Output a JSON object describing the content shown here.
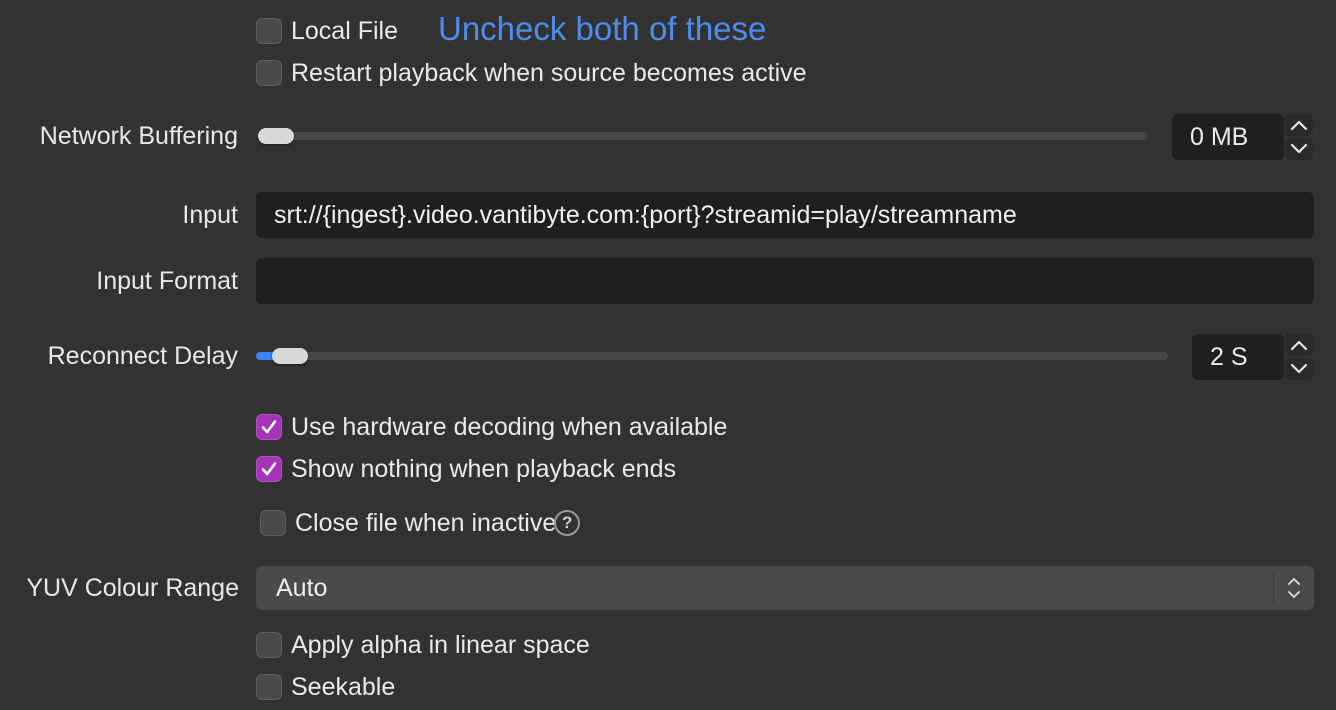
{
  "checkboxes": {
    "local_file": {
      "label": "Local File",
      "checked": false
    },
    "restart_playback": {
      "label": "Restart playback when source becomes active",
      "checked": false
    },
    "hw_decoding": {
      "label": "Use hardware decoding when available",
      "checked": true
    },
    "show_nothing": {
      "label": "Show nothing when playback ends",
      "checked": true
    },
    "close_file": {
      "label": "Close file when inactive",
      "checked": false
    },
    "apply_alpha": {
      "label": "Apply alpha in linear space",
      "checked": false
    },
    "seekable": {
      "label": "Seekable",
      "checked": false
    }
  },
  "annotation": {
    "text": "Uncheck both of these",
    "color": "#4f8cf0"
  },
  "network_buffering": {
    "label": "Network Buffering",
    "value": "0 MB",
    "level": 0.0
  },
  "input": {
    "label": "Input",
    "value": "srt://{ingest}.video.vantibyte.com:{port}?streamid=play/streamname"
  },
  "input_format": {
    "label": "Input Format",
    "value": ""
  },
  "reconnect_delay": {
    "label": "Reconnect Delay",
    "value": "2 S",
    "level": 0.017
  },
  "yuv_range": {
    "label": "YUV Colour Range",
    "value": "Auto"
  },
  "icons": {
    "help": "question-circle-icon",
    "check": "checkmark-icon",
    "stepper_up": "chevron-up-icon",
    "stepper_down": "chevron-down-icon",
    "select": "up-down-chevron-icon"
  },
  "colors": {
    "accent": "#3a82f7",
    "checkbox_checked": "#a534b8",
    "background": "#323232"
  }
}
